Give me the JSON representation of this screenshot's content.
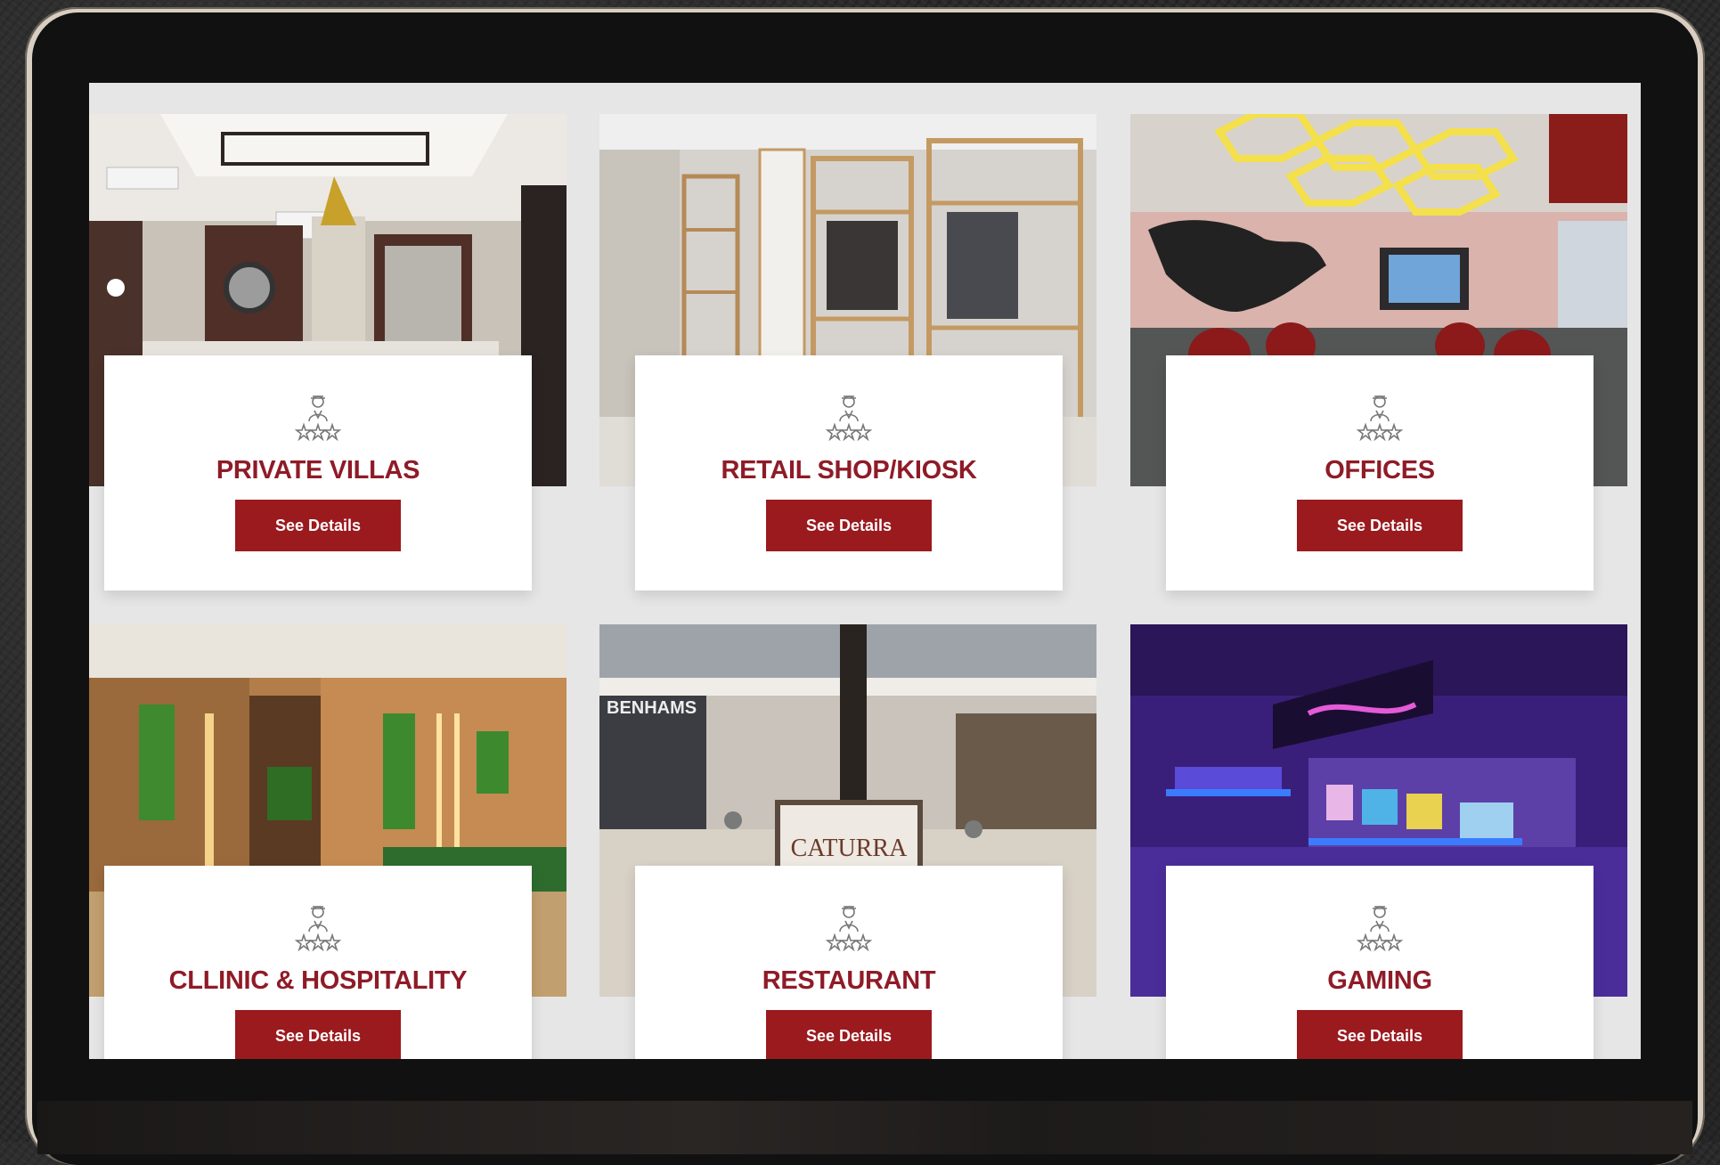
{
  "cards": [
    {
      "title": "PRIVATE VILLAS",
      "button": "See Details",
      "icon": "service-staff-icon"
    },
    {
      "title": "RETAIL SHOP/KIOSK",
      "button": "See Details",
      "icon": "service-staff-icon"
    },
    {
      "title": "OFFICES",
      "button": "See Details",
      "icon": "service-staff-icon"
    },
    {
      "title": "CLLINIC & HOSPITALITY",
      "button": "See Details",
      "icon": "service-staff-icon"
    },
    {
      "title": "RESTAURANT",
      "button": "See Details",
      "icon": "service-staff-icon"
    },
    {
      "title": "GAMING",
      "button": "See Details",
      "icon": "service-staff-icon"
    }
  ],
  "images": {
    "restaurant_sign": "CATURRA",
    "restaurant_store": "BENHAMS"
  },
  "colors": {
    "accent": "#9a1a1e",
    "title": "#8f1b27",
    "screen_bg": "#e6e6e6"
  }
}
